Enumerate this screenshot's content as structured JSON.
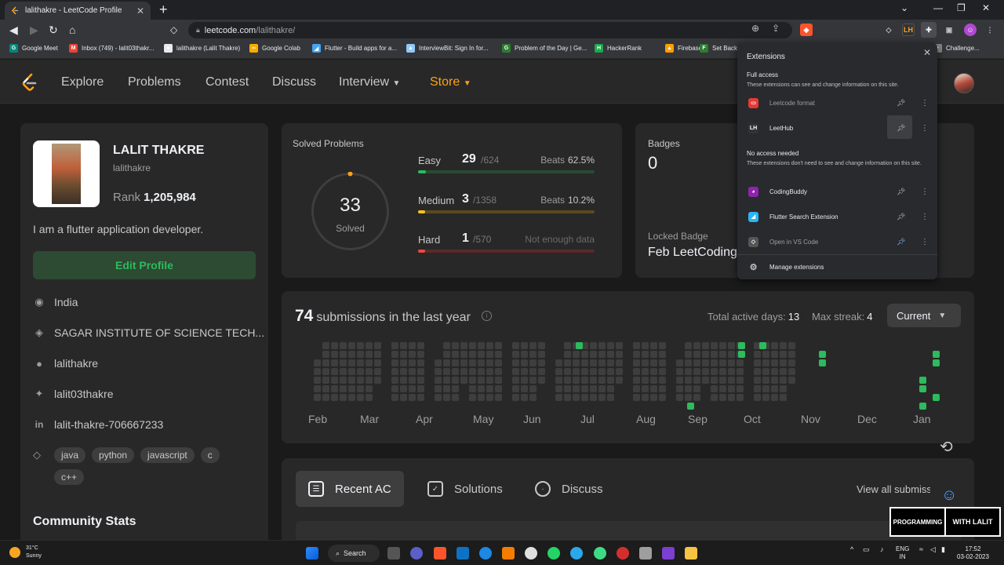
{
  "browser": {
    "tab_title": "lalithakre - LeetCode Profile",
    "url_host": "leetcode.com",
    "url_path": "/lalithakre/",
    "bookmarks": [
      {
        "label": "Google Meet",
        "color": "#00897b",
        "icon": "G"
      },
      {
        "label": "Inbox (749) - lalit03thakr...",
        "color": "#ea4335",
        "icon": "M"
      },
      {
        "label": "lalithakre (Lalit Thakre)",
        "color": "#e8eaed",
        "icon": "●"
      },
      {
        "label": "Google Colab",
        "color": "#f9ab00",
        "icon": "∞"
      },
      {
        "label": "Flutter - Build apps for a...",
        "color": "#42a5f5",
        "icon": "◢"
      },
      {
        "label": "InterviewBit: Sign In for...",
        "color": "#90caf9",
        "icon": "▲"
      },
      {
        "label": "Problem of the Day | Ge...",
        "color": "#2e7d32",
        "icon": "G"
      },
      {
        "label": "HackerRank",
        "color": "#1ba94c",
        "icon": "H"
      },
      {
        "label": "Firebase",
        "color": "#ffa000",
        "icon": "▲"
      },
      {
        "label": "Set Back",
        "color": "#2e7d32",
        "icon": "F"
      },
      {
        "label": "Challenge...",
        "color": "#888888",
        "icon": "•"
      }
    ]
  },
  "nav": {
    "items": [
      "Explore",
      "Problems",
      "Contest",
      "Discuss",
      "Interview"
    ],
    "store": "Store"
  },
  "profile": {
    "name": "LALIT THAKRE",
    "username": "lalithakre",
    "rank_label": "Rank",
    "rank_value": "1,205,984",
    "bio": "I am a flutter application developer.",
    "edit_button": "Edit Profile",
    "location": "India",
    "school": "SAGAR INSTITUTE OF SCIENCE TECH...",
    "github": "lalithakre",
    "twitter": "lalit03thakre",
    "linkedin": "lalit-thakre-706667233",
    "skills": [
      "java",
      "python",
      "javascript",
      "c",
      "c++"
    ],
    "community_stats": "Community Stats"
  },
  "solved": {
    "title": "Solved Problems",
    "total": "33",
    "total_label": "Solved",
    "easy": {
      "label": "Easy",
      "count": "29",
      "total": "/624",
      "beats_label": "Beats",
      "beats": "62.5%",
      "fill_fraction": 0.046,
      "color": "#2cbb5d",
      "track": "#2a4a33"
    },
    "medium": {
      "label": "Medium",
      "count": "3",
      "total": "/1358",
      "beats_label": "Beats",
      "beats": "10.2%",
      "fill_fraction": 0.002,
      "color": "#ffc01e",
      "track": "#5a4a1e"
    },
    "hard": {
      "label": "Hard",
      "count": "1",
      "total": "/570",
      "note": "Not enough data",
      "fill_fraction": 0.002,
      "color": "#ef4743",
      "track": "#5a2a2a"
    }
  },
  "badges": {
    "title": "Badges",
    "count": "0",
    "locked_title": "Locked Badge",
    "locked_name": "Feb LeetCoding"
  },
  "submissions": {
    "count": "74",
    "text": "submissions in the last year",
    "active_days_label": "Total active days:",
    "active_days": "13",
    "max_streak_label": "Max streak:",
    "max_streak": "4",
    "dropdown": "Current",
    "months": [
      "Feb",
      "Mar",
      "Apr",
      "May",
      "Jun",
      "Jul",
      "Aug",
      "Sep",
      "Oct",
      "Nov",
      "Dec",
      "Jan"
    ]
  },
  "tabs": {
    "recent_ac": "Recent AC",
    "solutions": "Solutions",
    "discuss": "Discuss",
    "view_all": "View all submissions"
  },
  "extensions": {
    "title": "Extensions",
    "full_access": "Full access",
    "full_access_desc": "These extensions can see and change information on this site.",
    "no_access": "No access needed",
    "no_access_desc": "These extensions don't need to see and change information on this site.",
    "full_items": [
      {
        "name": "Leetcode format",
        "icon": "▭",
        "color": "#e53935",
        "pinned": false,
        "dim": true
      },
      {
        "name": "LeetHub",
        "icon": "LH",
        "color": "#333333",
        "pinned": false,
        "dim": false
      }
    ],
    "none_items": [
      {
        "name": "CodingBuddy",
        "icon": "◕",
        "color": "#8e24aa",
        "pinned": false,
        "dim": false
      },
      {
        "name": "Flutter Search Extension",
        "icon": "◢",
        "color": "#29b6f6",
        "pinned": false,
        "dim": false
      },
      {
        "name": "Open in VS Code",
        "icon": "◇",
        "color": "#555555",
        "pinned": true,
        "dim": true
      }
    ],
    "manage": "Manage extensions"
  },
  "watermark": {
    "left": "PROGRAMMING",
    "right": "WITH LALIT"
  },
  "taskbar": {
    "temp": "31°C",
    "weather": "Sunny",
    "search": "Search",
    "lang1": "ENG",
    "lang2": "IN",
    "time": "17:52",
    "date": "03-02-2023"
  },
  "colors": {
    "accent_orange": "#ffa116",
    "green": "#2cbb5d"
  }
}
